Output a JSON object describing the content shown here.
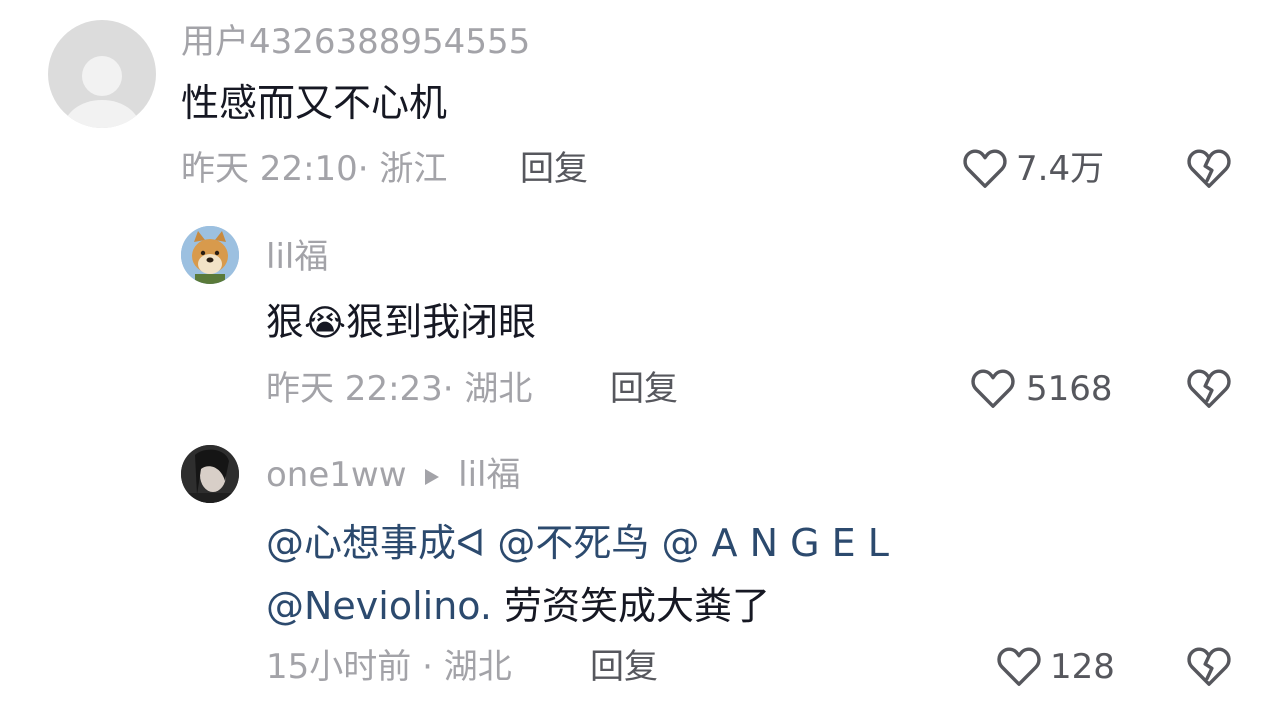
{
  "comments": [
    {
      "username": "用户4326388954555",
      "text": "性感而又不心机",
      "time": "昨天 22:10",
      "sep": "·",
      "location": "浙江",
      "reply_label": "回复",
      "likes": "7.4万"
    },
    {
      "username": "lil福",
      "text_part1": "狠",
      "text_emoji": "😭",
      "text_part2": "狠到我闭眼",
      "time": "昨天 22:23",
      "sep": "·",
      "location": "湖北",
      "reply_label": "回复",
      "likes": "5168"
    },
    {
      "username": "one1ww",
      "reply_to": "lil福",
      "mention1": "@心想事成ᐊ",
      "mention2": "@不死鸟",
      "mention3": "@ A N G E L",
      "mention4": "@Neviolino.",
      "text_rest": " 劳资笑成大粪了",
      "time": "15小时前",
      "sep": "·",
      "location": "湖北",
      "reply_label": "回复",
      "likes": "128"
    }
  ],
  "colors": {
    "text": "#161823",
    "meta": "#a3a3a8",
    "action": "#56575d",
    "mention": "#2c4a6e"
  },
  "icons": {
    "like": "heart-outline-icon",
    "dislike": "broken-heart-icon",
    "reply_arrow": "play-arrow-icon"
  }
}
